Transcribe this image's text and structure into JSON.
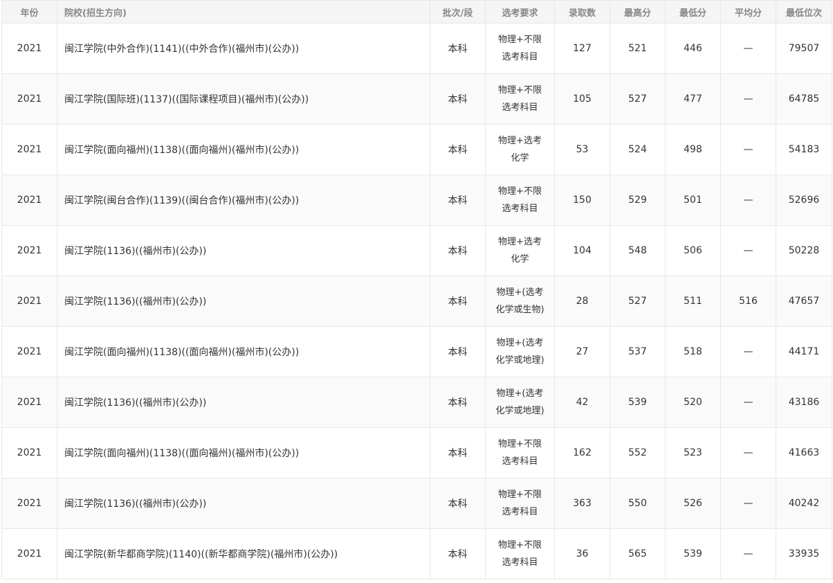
{
  "headers": {
    "year": "年份",
    "school": "院校(招生方向)",
    "batch": "批次/段",
    "requirement": "选考要求",
    "admitted": "录取数",
    "max": "最高分",
    "min": "最低分",
    "avg": "平均分",
    "min_rank": "最低位次"
  },
  "rows": [
    {
      "year": "2021",
      "school": "闽江学院(中外合作)(1141)((中外合作)(福州市)(公办))",
      "batch": "本科",
      "req1": "物理+不限",
      "req2": "选考科目",
      "admitted": "127",
      "max": "521",
      "min": "446",
      "avg": "—",
      "min_rank": "79507"
    },
    {
      "year": "2021",
      "school": "闽江学院(国际班)(1137)((国际课程项目)(福州市)(公办))",
      "batch": "本科",
      "req1": "物理+不限",
      "req2": "选考科目",
      "admitted": "105",
      "max": "527",
      "min": "477",
      "avg": "—",
      "min_rank": "64785"
    },
    {
      "year": "2021",
      "school": "闽江学院(面向福州)(1138)((面向福州)(福州市)(公办))",
      "batch": "本科",
      "req1": "物理+选考",
      "req2": "化学",
      "admitted": "53",
      "max": "524",
      "min": "498",
      "avg": "—",
      "min_rank": "54183"
    },
    {
      "year": "2021",
      "school": "闽江学院(闽台合作)(1139)((闽台合作)(福州市)(公办))",
      "batch": "本科",
      "req1": "物理+不限",
      "req2": "选考科目",
      "admitted": "150",
      "max": "529",
      "min": "501",
      "avg": "—",
      "min_rank": "52696"
    },
    {
      "year": "2021",
      "school": "闽江学院(1136)((福州市)(公办))",
      "batch": "本科",
      "req1": "物理+选考",
      "req2": "化学",
      "admitted": "104",
      "max": "548",
      "min": "506",
      "avg": "—",
      "min_rank": "50228"
    },
    {
      "year": "2021",
      "school": "闽江学院(1136)((福州市)(公办))",
      "batch": "本科",
      "req1": "物理+(选考",
      "req2": "化学或生物)",
      "admitted": "28",
      "max": "527",
      "min": "511",
      "avg": "516",
      "min_rank": "47657"
    },
    {
      "year": "2021",
      "school": "闽江学院(面向福州)(1138)((面向福州)(福州市)(公办))",
      "batch": "本科",
      "req1": "物理+(选考",
      "req2": "化学或地理)",
      "admitted": "27",
      "max": "537",
      "min": "518",
      "avg": "—",
      "min_rank": "44171"
    },
    {
      "year": "2021",
      "school": "闽江学院(1136)((福州市)(公办))",
      "batch": "本科",
      "req1": "物理+(选考",
      "req2": "化学或地理)",
      "admitted": "42",
      "max": "539",
      "min": "520",
      "avg": "—",
      "min_rank": "43186"
    },
    {
      "year": "2021",
      "school": "闽江学院(面向福州)(1138)((面向福州)(福州市)(公办))",
      "batch": "本科",
      "req1": "物理+不限",
      "req2": "选考科目",
      "admitted": "162",
      "max": "552",
      "min": "523",
      "avg": "—",
      "min_rank": "41663"
    },
    {
      "year": "2021",
      "school": "闽江学院(1136)((福州市)(公办))",
      "batch": "本科",
      "req1": "物理+不限",
      "req2": "选考科目",
      "admitted": "363",
      "max": "550",
      "min": "526",
      "avg": "—",
      "min_rank": "40242"
    },
    {
      "year": "2021",
      "school": "闽江学院(新华都商学院)(1140)((新华都商学院)(福州市)(公办))",
      "batch": "本科",
      "req1": "物理+不限",
      "req2": "选考科目",
      "admitted": "36",
      "max": "565",
      "min": "539",
      "avg": "—",
      "min_rank": "33935"
    }
  ],
  "colors": {
    "header_bg": "#f5f5f5",
    "header_text": "#888888",
    "border": "#e8e8e8",
    "stripe": "#fafafa",
    "text": "#333333"
  }
}
